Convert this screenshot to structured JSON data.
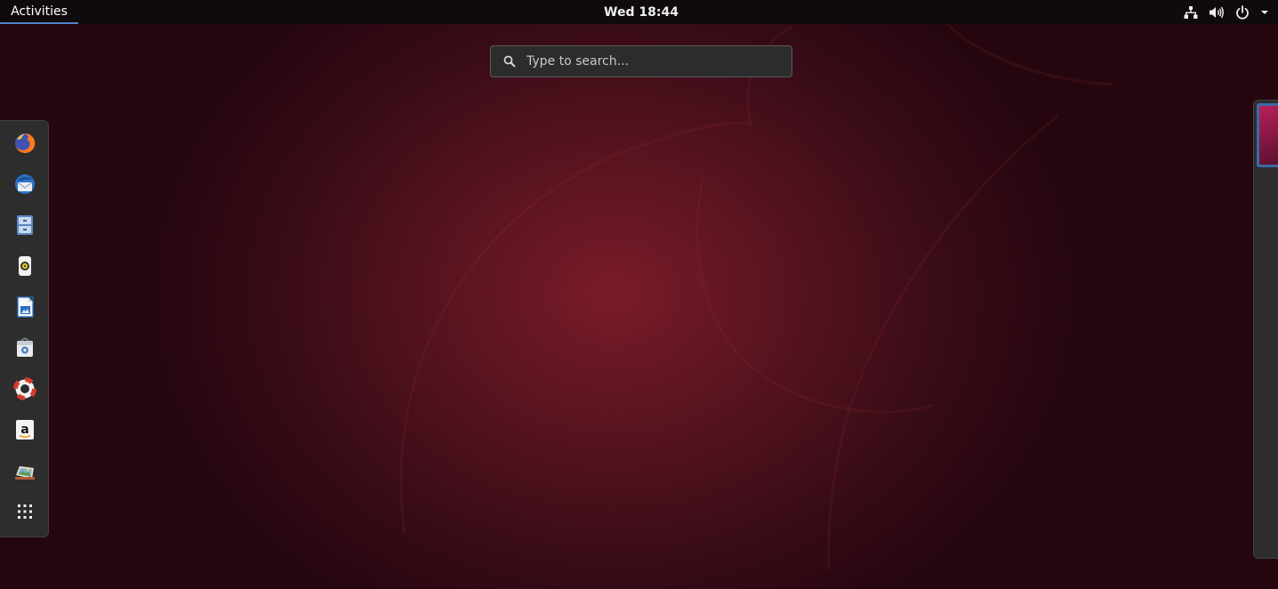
{
  "topbar": {
    "activities_label": "Activities",
    "clock": "Wed 18:44",
    "tray_icons": [
      "network-icon",
      "volume-icon",
      "power-icon",
      "dropdown-arrow-icon"
    ]
  },
  "search": {
    "placeholder": "Type to search..."
  },
  "dock": {
    "items": [
      {
        "name": "firefox",
        "icon": "firefox-icon"
      },
      {
        "name": "thunderbird",
        "icon": "thunderbird-icon"
      },
      {
        "name": "files",
        "icon": "files-icon"
      },
      {
        "name": "rhythmbox",
        "icon": "rhythmbox-icon"
      },
      {
        "name": "libreoffice-writer",
        "icon": "writer-icon"
      },
      {
        "name": "software",
        "icon": "software-icon"
      },
      {
        "name": "help",
        "icon": "help-icon"
      },
      {
        "name": "amazon",
        "icon": "amazon-icon"
      },
      {
        "name": "photo-viewer",
        "icon": "photos-icon"
      },
      {
        "name": "show-applications",
        "icon": "apps-grid-icon"
      }
    ]
  },
  "colors": {
    "topbar_bg": "#0f0a0b",
    "accent": "#4f84c7",
    "dock_bg": "#2d2d2d",
    "wallpaper_center": "#7a1c28"
  }
}
